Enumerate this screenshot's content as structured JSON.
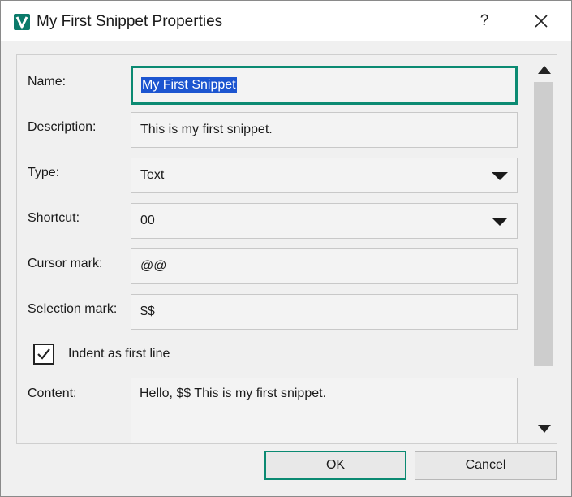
{
  "window": {
    "title": "My First Snippet Properties",
    "help_label": "?",
    "close_label": "✕"
  },
  "form": {
    "name_label": "Name:",
    "name_value": "My First Snippet",
    "description_label": "Description:",
    "description_value": "This is my first snippet.",
    "type_label": "Type:",
    "type_value": "Text",
    "shortcut_label": "Shortcut:",
    "shortcut_value": "00",
    "cursor_mark_label": "Cursor mark:",
    "cursor_mark_value": "@@",
    "selection_mark_label": "Selection mark:",
    "selection_mark_value": "$$",
    "indent_label": "Indent as first line",
    "indent_checked": true,
    "content_label": "Content:",
    "content_value": "Hello, $$ This is my first snippet."
  },
  "buttons": {
    "ok_label": "OK",
    "cancel_label": "Cancel"
  },
  "colors": {
    "accent": "#0b8a72",
    "selection": "#1c55d0",
    "app_icon": "#0b7a6a"
  },
  "icons": {
    "app": "vim-logo-icon",
    "help": "question-icon",
    "close": "close-icon",
    "scroll_up": "triangle-up-icon",
    "scroll_down": "triangle-down-icon",
    "dropdown": "triangle-down-icon",
    "check": "checkmark-icon"
  }
}
